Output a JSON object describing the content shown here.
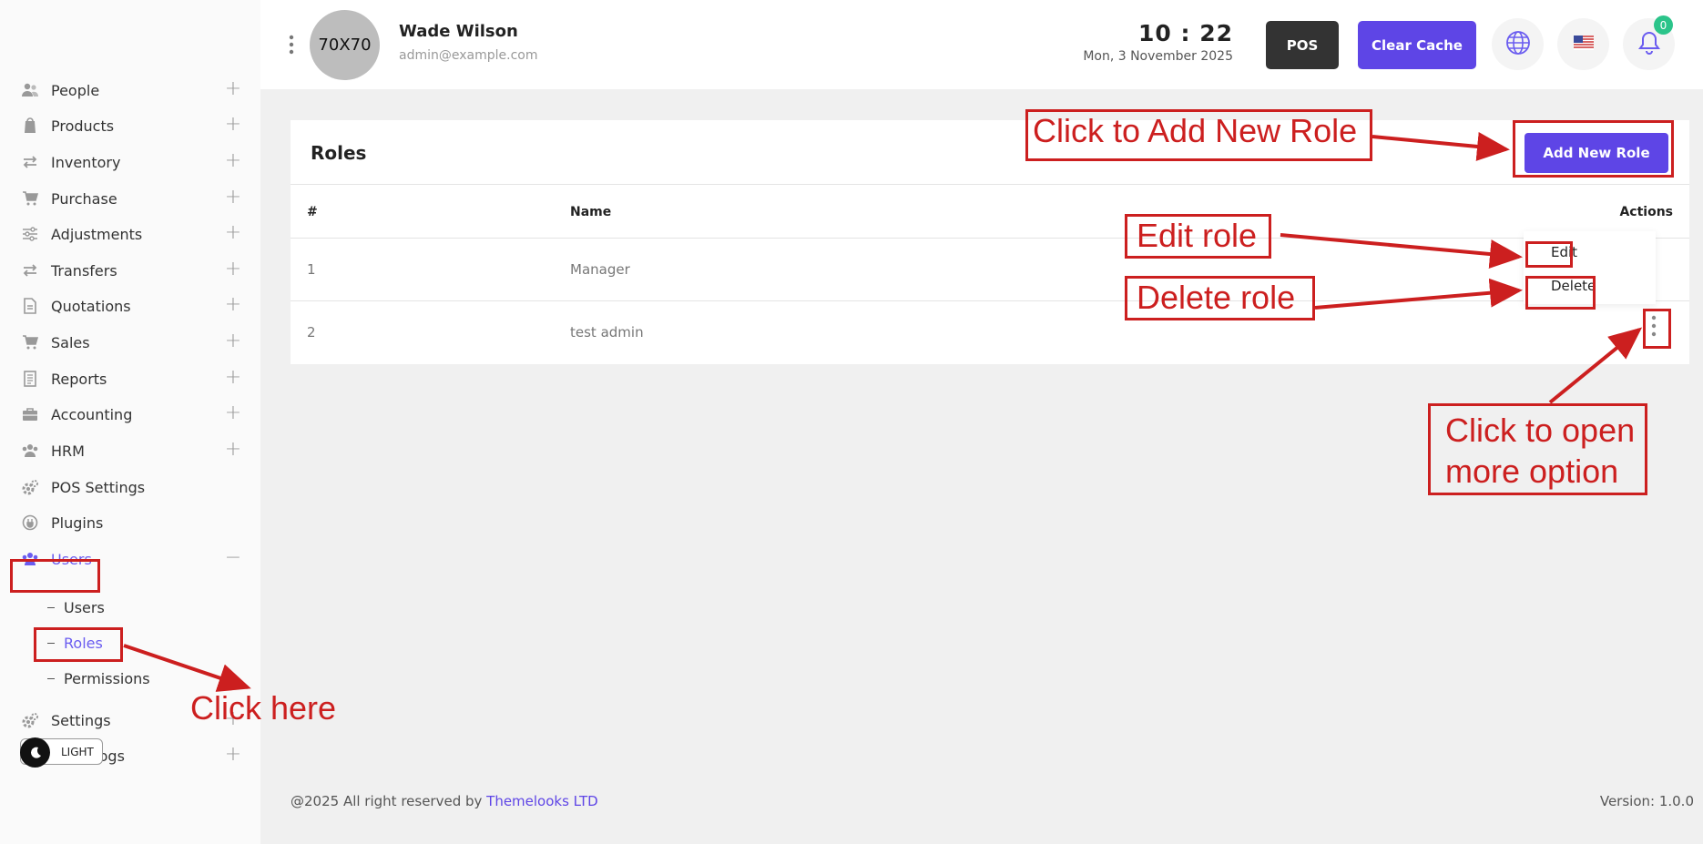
{
  "header": {
    "avatar_text": "70X70",
    "user_name": "Wade Wilson",
    "user_email": "admin@example.com",
    "time": "10 : 22",
    "date": "Mon, 3 November 2025",
    "pos_label": "POS",
    "clear_cache_label": "Clear Cache",
    "notification_count": "0"
  },
  "sidebar": {
    "items": [
      {
        "label": "People",
        "icon": "people-icon"
      },
      {
        "label": "Products",
        "icon": "products-icon"
      },
      {
        "label": "Inventory",
        "icon": "inventory-icon"
      },
      {
        "label": "Purchase",
        "icon": "cart-icon"
      },
      {
        "label": "Adjustments",
        "icon": "sliders-icon"
      },
      {
        "label": "Transfers",
        "icon": "transfer-icon"
      },
      {
        "label": "Quotations",
        "icon": "document-icon"
      },
      {
        "label": "Sales",
        "icon": "cart-icon"
      },
      {
        "label": "Reports",
        "icon": "report-icon"
      },
      {
        "label": "Accounting",
        "icon": "briefcase-icon"
      },
      {
        "label": "HRM",
        "icon": "team-icon"
      },
      {
        "label": "POS Settings",
        "icon": "gears-icon"
      },
      {
        "label": "Plugins",
        "icon": "plug-icon"
      },
      {
        "label": "Users",
        "icon": "users-icon"
      }
    ],
    "users_sub": [
      "Users",
      "Roles",
      "Permissions"
    ],
    "settings_label": "Settings",
    "logs_label": "Logs",
    "theme_label": "LIGHT"
  },
  "main": {
    "title": "Roles",
    "add_button": "Add New Role",
    "columns": [
      "#",
      "Name",
      "Actions"
    ],
    "rows": [
      {
        "id": "1",
        "name": "Manager"
      },
      {
        "id": "2",
        "name": "test admin"
      }
    ],
    "dropdown": {
      "edit": "Edit",
      "delete": "Delete"
    }
  },
  "footer": {
    "copyright": "@2025 All right reserved by ",
    "company": "Themelooks LTD",
    "version": "Version: 1.0.0"
  },
  "annotations": {
    "add_role": "Click to Add New Role",
    "edit_role": "Edit role",
    "delete_role": "Delete role",
    "more_option_1": "Click to open",
    "more_option_2": "more option",
    "click_here": "Click here"
  },
  "colors": {
    "accent": "#5e45e6",
    "annotation": "#cc1f1f",
    "dark_button": "#333333"
  }
}
